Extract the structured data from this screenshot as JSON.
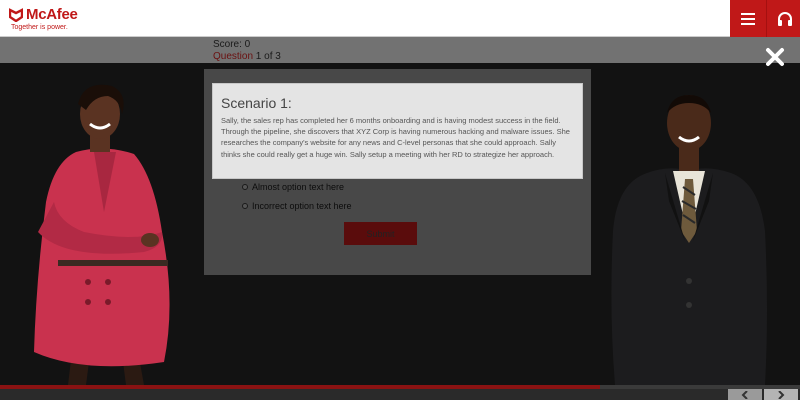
{
  "header": {
    "brand": "McAfee",
    "tagline": "Together is power.",
    "menu_icon": "hamburger-icon",
    "audio_icon": "headphones-icon",
    "accent": "#c01818"
  },
  "quiz": {
    "score_label": "Score: 0",
    "question_word": "Question",
    "question_rest": " 1 of 3",
    "options": [
      "Almost option text here",
      "Incorrect option text here"
    ],
    "submit_label": "Submit"
  },
  "modal": {
    "title": "Scenario 1:",
    "body": "Sally, the sales rep has completed her 6 months onboarding and is having modest success in the field. Through the pipeline, she discovers that XYZ Corp is having numerous hacking and malware issues. She researches the company's website for any news and C-level personas that she could approach. Sally thinks she could really get a huge win. Sally setup a meeting with her RD to strategize her approach."
  },
  "progress": {
    "percent": 75
  },
  "nav": {
    "prev_icon": "chevron-left-icon",
    "next_icon": "chevron-right-icon"
  }
}
